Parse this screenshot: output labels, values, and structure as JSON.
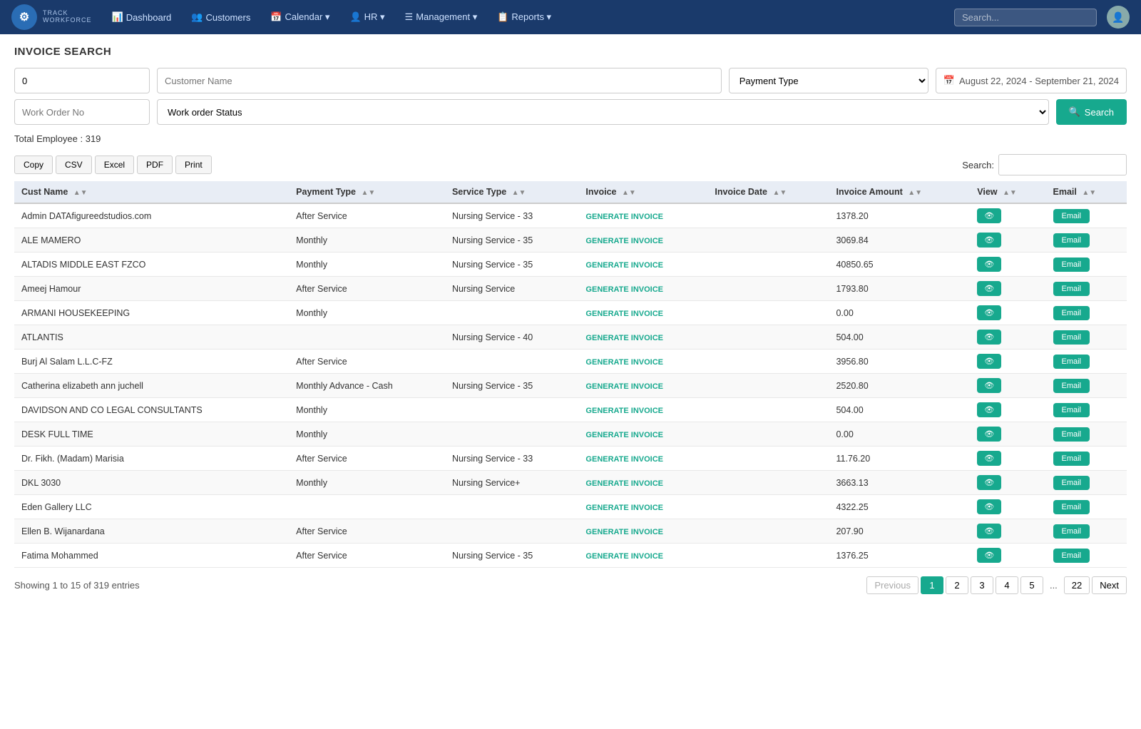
{
  "app": {
    "brand_name": "TRACK",
    "brand_sub": "WORKFORCE",
    "brand_icon": "⚙"
  },
  "nav": {
    "items": [
      {
        "label": "Dashboard",
        "icon": "📊"
      },
      {
        "label": "Customers",
        "icon": "👥"
      },
      {
        "label": "Calendar ▾",
        "icon": "📅"
      },
      {
        "label": "HR ▾",
        "icon": "👤"
      },
      {
        "label": "Management ▾",
        "icon": "☰"
      },
      {
        "label": "Reports ▾",
        "icon": "📋"
      }
    ],
    "search_placeholder": "Search..."
  },
  "page": {
    "title": "INVOICE SEARCH"
  },
  "filters": {
    "invoice_value": "0",
    "invoice_placeholder": "0",
    "customer_name_placeholder": "Customer Name",
    "payment_type_placeholder": "Payment Type",
    "work_order_no_placeholder": "Work Order No",
    "work_order_status_placeholder": "Work order Status",
    "date_range": "August 22, 2024 - September 21, 2024",
    "search_btn": "Search"
  },
  "total": {
    "label": "Total Employee : 319"
  },
  "toolbar": {
    "copy": "Copy",
    "csv": "CSV",
    "excel": "Excel",
    "pdf": "PDF",
    "print": "Print",
    "search_label": "Search:",
    "search_placeholder": ""
  },
  "table": {
    "columns": [
      {
        "key": "cust_name",
        "label": "Cust Name"
      },
      {
        "key": "payment_type",
        "label": "Payment Type"
      },
      {
        "key": "service_type",
        "label": "Service Type"
      },
      {
        "key": "invoice",
        "label": "Invoice"
      },
      {
        "key": "invoice_date",
        "label": "Invoice Date"
      },
      {
        "key": "invoice_amount",
        "label": "Invoice Amount"
      },
      {
        "key": "view",
        "label": "View"
      },
      {
        "key": "email",
        "label": "Email"
      }
    ],
    "rows": [
      {
        "cust_name": "Admin DATAfigureedstudios.com",
        "payment_type": "After Service",
        "service_type": "Nursing Service - 33",
        "invoice": "GENERATE INVOICE",
        "invoice_date": "",
        "invoice_amount": "1378.20",
        "view": "👁",
        "email": "Email"
      },
      {
        "cust_name": "ALE MAMERO",
        "payment_type": "Monthly",
        "service_type": "Nursing Service - 35",
        "invoice": "GENERATE INVOICE",
        "invoice_date": "",
        "invoice_amount": "3069.84",
        "view": "👁",
        "email": "Email"
      },
      {
        "cust_name": "ALTADIS MIDDLE EAST FZCO",
        "payment_type": "Monthly",
        "service_type": "Nursing Service - 35",
        "invoice": "GENERATE INVOICE",
        "invoice_date": "",
        "invoice_amount": "40850.65",
        "view": "👁",
        "email": "Email"
      },
      {
        "cust_name": "Ameej Hamour",
        "payment_type": "After Service",
        "service_type": "Nursing Service",
        "invoice": "GENERATE INVOICE",
        "invoice_date": "",
        "invoice_amount": "1793.80",
        "view": "👁",
        "email": "Email"
      },
      {
        "cust_name": "ARMANI HOUSEKEEPING",
        "payment_type": "Monthly",
        "service_type": "",
        "invoice": "GENERATE INVOICE",
        "invoice_date": "",
        "invoice_amount": "0.00",
        "view": "👁",
        "email": "Email"
      },
      {
        "cust_name": "ATLANTIS",
        "payment_type": "",
        "service_type": "Nursing Service - 40",
        "invoice": "GENERATE INVOICE",
        "invoice_date": "",
        "invoice_amount": "504.00",
        "view": "👁",
        "email": "Email"
      },
      {
        "cust_name": "Burj Al Salam L.L.C-FZ",
        "payment_type": "After Service",
        "service_type": "",
        "invoice": "GENERATE INVOICE",
        "invoice_date": "",
        "invoice_amount": "3956.80",
        "view": "👁",
        "email": "Email"
      },
      {
        "cust_name": "Catherina elizabeth ann juchell",
        "payment_type": "Monthly Advance - Cash",
        "service_type": "Nursing Service - 35",
        "invoice": "GENERATE INVOICE",
        "invoice_date": "",
        "invoice_amount": "2520.80",
        "view": "👁",
        "email": "Email"
      },
      {
        "cust_name": "DAVIDSON AND CO LEGAL CONSULTANTS",
        "payment_type": "Monthly",
        "service_type": "",
        "invoice": "GENERATE INVOICE",
        "invoice_date": "",
        "invoice_amount": "504.00",
        "view": "👁",
        "email": "Email"
      },
      {
        "cust_name": "DESK FULL TIME",
        "payment_type": "Monthly",
        "service_type": "",
        "invoice": "GENERATE INVOICE",
        "invoice_date": "",
        "invoice_amount": "0.00",
        "view": "👁",
        "email": "Email"
      },
      {
        "cust_name": "Dr. Fikh. (Madam) Marisia",
        "payment_type": "After Service",
        "service_type": "Nursing Service - 33",
        "invoice": "GENERATE INVOICE",
        "invoice_date": "",
        "invoice_amount": "11.76.20",
        "view": "👁",
        "email": "Email"
      },
      {
        "cust_name": "DKL 3030",
        "payment_type": "Monthly",
        "service_type": "Nursing Service+",
        "invoice": "GENERATE INVOICE",
        "invoice_date": "",
        "invoice_amount": "3663.13",
        "view": "👁",
        "email": "Email"
      },
      {
        "cust_name": "Eden Gallery LLC",
        "payment_type": "",
        "service_type": "",
        "invoice": "GENERATE INVOICE",
        "invoice_date": "",
        "invoice_amount": "4322.25",
        "view": "👁",
        "email": "Email"
      },
      {
        "cust_name": "Ellen B. Wijanardana",
        "payment_type": "After Service",
        "service_type": "",
        "invoice": "GENERATE INVOICE",
        "invoice_date": "",
        "invoice_amount": "207.90",
        "view": "👁",
        "email": "Email"
      },
      {
        "cust_name": "Fatima Mohammed",
        "payment_type": "After Service",
        "service_type": "Nursing Service - 35",
        "invoice": "GENERATE INVOICE",
        "invoice_date": "",
        "invoice_amount": "1376.25",
        "view": "👁",
        "email": "Email"
      }
    ]
  },
  "pagination": {
    "showing": "Showing 1 to 15 of 319 entries",
    "previous_label": "Previous",
    "next_label": "Next",
    "current_page": 1,
    "pages": [
      1,
      2,
      3,
      4,
      5
    ],
    "last_page": 22,
    "ellipsis": "..."
  }
}
